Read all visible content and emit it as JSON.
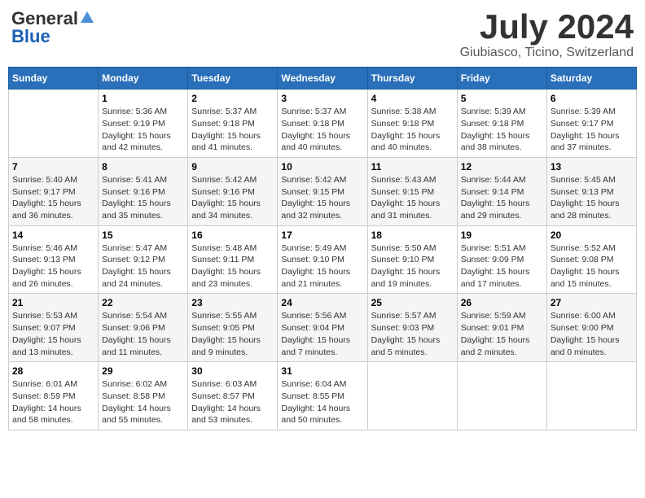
{
  "header": {
    "logo": {
      "general": "General",
      "blue": "Blue"
    },
    "title": "July 2024",
    "location": "Giubiasco, Ticino, Switzerland"
  },
  "weekdays": [
    "Sunday",
    "Monday",
    "Tuesday",
    "Wednesday",
    "Thursday",
    "Friday",
    "Saturday"
  ],
  "weeks": [
    [
      {
        "day": "",
        "info": ""
      },
      {
        "day": "1",
        "info": "Sunrise: 5:36 AM\nSunset: 9:19 PM\nDaylight: 15 hours\nand 42 minutes."
      },
      {
        "day": "2",
        "info": "Sunrise: 5:37 AM\nSunset: 9:18 PM\nDaylight: 15 hours\nand 41 minutes."
      },
      {
        "day": "3",
        "info": "Sunrise: 5:37 AM\nSunset: 9:18 PM\nDaylight: 15 hours\nand 40 minutes."
      },
      {
        "day": "4",
        "info": "Sunrise: 5:38 AM\nSunset: 9:18 PM\nDaylight: 15 hours\nand 40 minutes."
      },
      {
        "day": "5",
        "info": "Sunrise: 5:39 AM\nSunset: 9:18 PM\nDaylight: 15 hours\nand 38 minutes."
      },
      {
        "day": "6",
        "info": "Sunrise: 5:39 AM\nSunset: 9:17 PM\nDaylight: 15 hours\nand 37 minutes."
      }
    ],
    [
      {
        "day": "7",
        "info": "Sunrise: 5:40 AM\nSunset: 9:17 PM\nDaylight: 15 hours\nand 36 minutes."
      },
      {
        "day": "8",
        "info": "Sunrise: 5:41 AM\nSunset: 9:16 PM\nDaylight: 15 hours\nand 35 minutes."
      },
      {
        "day": "9",
        "info": "Sunrise: 5:42 AM\nSunset: 9:16 PM\nDaylight: 15 hours\nand 34 minutes."
      },
      {
        "day": "10",
        "info": "Sunrise: 5:42 AM\nSunset: 9:15 PM\nDaylight: 15 hours\nand 32 minutes."
      },
      {
        "day": "11",
        "info": "Sunrise: 5:43 AM\nSunset: 9:15 PM\nDaylight: 15 hours\nand 31 minutes."
      },
      {
        "day": "12",
        "info": "Sunrise: 5:44 AM\nSunset: 9:14 PM\nDaylight: 15 hours\nand 29 minutes."
      },
      {
        "day": "13",
        "info": "Sunrise: 5:45 AM\nSunset: 9:13 PM\nDaylight: 15 hours\nand 28 minutes."
      }
    ],
    [
      {
        "day": "14",
        "info": "Sunrise: 5:46 AM\nSunset: 9:13 PM\nDaylight: 15 hours\nand 26 minutes."
      },
      {
        "day": "15",
        "info": "Sunrise: 5:47 AM\nSunset: 9:12 PM\nDaylight: 15 hours\nand 24 minutes."
      },
      {
        "day": "16",
        "info": "Sunrise: 5:48 AM\nSunset: 9:11 PM\nDaylight: 15 hours\nand 23 minutes."
      },
      {
        "day": "17",
        "info": "Sunrise: 5:49 AM\nSunset: 9:10 PM\nDaylight: 15 hours\nand 21 minutes."
      },
      {
        "day": "18",
        "info": "Sunrise: 5:50 AM\nSunset: 9:10 PM\nDaylight: 15 hours\nand 19 minutes."
      },
      {
        "day": "19",
        "info": "Sunrise: 5:51 AM\nSunset: 9:09 PM\nDaylight: 15 hours\nand 17 minutes."
      },
      {
        "day": "20",
        "info": "Sunrise: 5:52 AM\nSunset: 9:08 PM\nDaylight: 15 hours\nand 15 minutes."
      }
    ],
    [
      {
        "day": "21",
        "info": "Sunrise: 5:53 AM\nSunset: 9:07 PM\nDaylight: 15 hours\nand 13 minutes."
      },
      {
        "day": "22",
        "info": "Sunrise: 5:54 AM\nSunset: 9:06 PM\nDaylight: 15 hours\nand 11 minutes."
      },
      {
        "day": "23",
        "info": "Sunrise: 5:55 AM\nSunset: 9:05 PM\nDaylight: 15 hours\nand 9 minutes."
      },
      {
        "day": "24",
        "info": "Sunrise: 5:56 AM\nSunset: 9:04 PM\nDaylight: 15 hours\nand 7 minutes."
      },
      {
        "day": "25",
        "info": "Sunrise: 5:57 AM\nSunset: 9:03 PM\nDaylight: 15 hours\nand 5 minutes."
      },
      {
        "day": "26",
        "info": "Sunrise: 5:59 AM\nSunset: 9:01 PM\nDaylight: 15 hours\nand 2 minutes."
      },
      {
        "day": "27",
        "info": "Sunrise: 6:00 AM\nSunset: 9:00 PM\nDaylight: 15 hours\nand 0 minutes."
      }
    ],
    [
      {
        "day": "28",
        "info": "Sunrise: 6:01 AM\nSunset: 8:59 PM\nDaylight: 14 hours\nand 58 minutes."
      },
      {
        "day": "29",
        "info": "Sunrise: 6:02 AM\nSunset: 8:58 PM\nDaylight: 14 hours\nand 55 minutes."
      },
      {
        "day": "30",
        "info": "Sunrise: 6:03 AM\nSunset: 8:57 PM\nDaylight: 14 hours\nand 53 minutes."
      },
      {
        "day": "31",
        "info": "Sunrise: 6:04 AM\nSunset: 8:55 PM\nDaylight: 14 hours\nand 50 minutes."
      },
      {
        "day": "",
        "info": ""
      },
      {
        "day": "",
        "info": ""
      },
      {
        "day": "",
        "info": ""
      }
    ]
  ]
}
